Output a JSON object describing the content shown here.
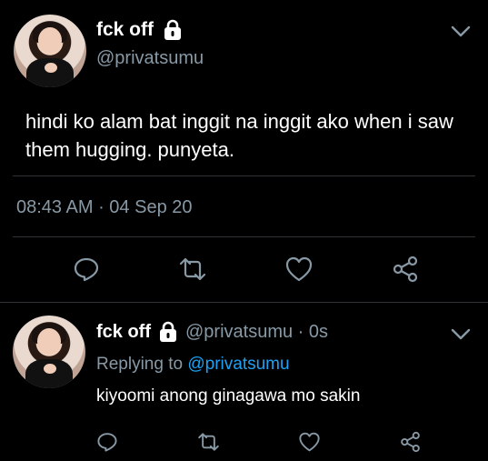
{
  "main_tweet": {
    "display_name": "fck off",
    "handle": "@privatsumu",
    "text": "hindi ko alam bat inggit na inggit ako when i saw them hugging. punyeta.",
    "time": "08:43 AM",
    "separator": " · ",
    "date": "04 Sep 20",
    "icons": [
      "lock-icon",
      "chevron-down-icon",
      "reply-icon",
      "retweet-icon",
      "like-icon",
      "share-icon"
    ]
  },
  "reply_tweet": {
    "display_name": "fck off",
    "handle": "@privatsumu",
    "age": " · 0s",
    "replying_prefix": "Replying to ",
    "replying_to": "@privatsumu",
    "text": "kiyoomi anong ginagawa mo sakin",
    "icons": [
      "lock-icon",
      "chevron-down-icon",
      "reply-icon",
      "retweet-icon",
      "like-icon",
      "share-icon"
    ]
  },
  "colors": {
    "background": "#000000",
    "secondary_text": "#8899a6",
    "link": "#1da1f2",
    "divider": "#2f3336"
  }
}
